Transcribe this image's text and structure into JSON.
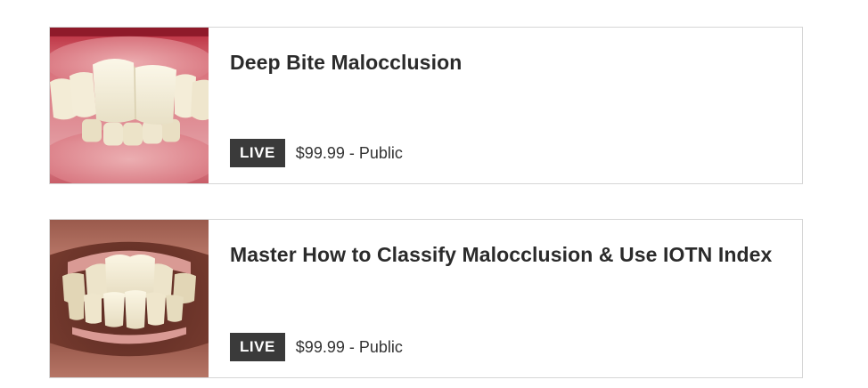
{
  "courses": [
    {
      "title": "Deep Bite Malocclusion",
      "status": "LIVE",
      "price_visibility": "$99.99 - Public",
      "image_icon": "deep-bite-teeth-photo"
    },
    {
      "title": "Master How to Classify Malocclusion & Use IOTN Index",
      "status": "LIVE",
      "price_visibility": "$99.99 - Public",
      "image_icon": "malocclusion-teeth-photo"
    }
  ],
  "colors": {
    "badge_bg": "#3a3a3a",
    "border": "#d6d6d6",
    "title_text": "#2b2b2b"
  }
}
